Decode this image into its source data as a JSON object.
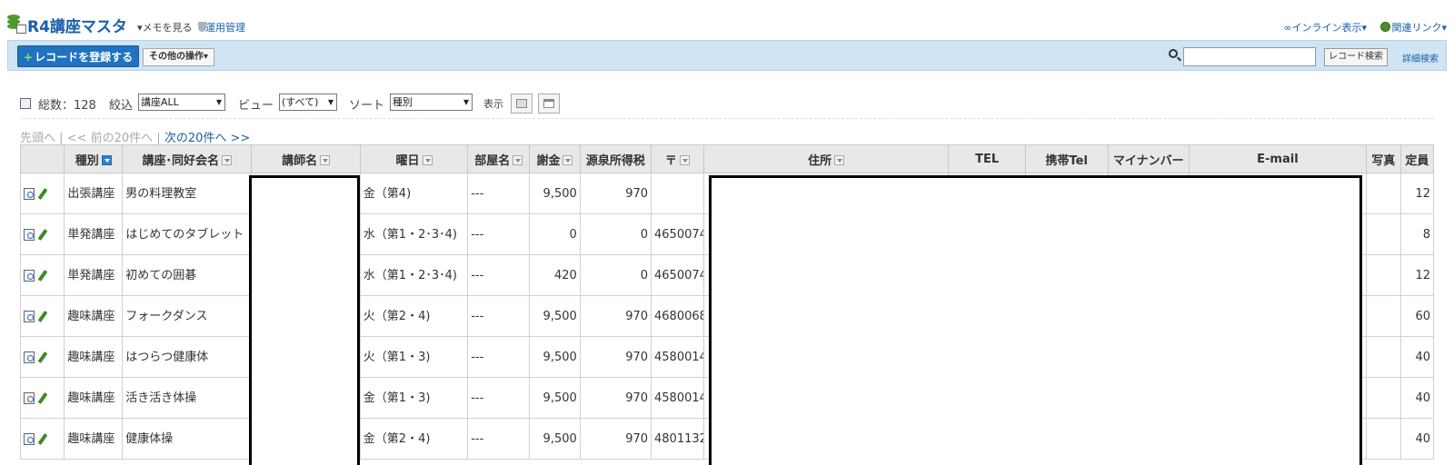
{
  "title": {
    "app": "R4講座マスタ",
    "memo": "▾メモを見る",
    "ops_admin": "運用管理",
    "inline_view": "∞インライン表示▾",
    "related_links": "関連リンク▾"
  },
  "toolbar": {
    "add_record": "レコードを登録する",
    "other_ops": "その他の操作▾",
    "search_placeholder": "",
    "search_button": "レコード検索",
    "advanced_search": "詳細検索"
  },
  "filter": {
    "total_label": "総数：128",
    "filter_label": "絞込",
    "filter_value": "講座ALL",
    "view_label": "ビュー",
    "view_value": "(すべて)",
    "sort_label": "ソート",
    "sort_value": "種別",
    "display_label": "表示"
  },
  "pager": {
    "first": "先頭へ",
    "sep1": "|",
    "prev": "<< 前の20件へ",
    "sep2": "|",
    "next": "次の20件へ >>"
  },
  "table": {
    "headers": [
      "",
      "種別",
      "講座･同好会名",
      "講師名",
      "曜日",
      "部屋名",
      "謝金",
      "源泉所得税",
      "〒",
      "住所",
      "TEL",
      "携帯Tel",
      "マイナンバー",
      "E-mail",
      "写真",
      "定員"
    ],
    "rows": [
      {
        "type": "出張講座",
        "name": "男の料理教室",
        "day": "金（第4)",
        "room": "---",
        "fee": "9,500",
        "tax": "970",
        "zip": "",
        "capacity": "12"
      },
      {
        "type": "単発講座",
        "name": "はじめてのタブレット",
        "day": "水（第1・2･3･4)",
        "room": "---",
        "fee": "0",
        "tax": "0",
        "zip": "4650074",
        "capacity": "8"
      },
      {
        "type": "単発講座",
        "name": "初めての囲碁",
        "day": "水（第1・2･3･4)",
        "room": "---",
        "fee": "420",
        "tax": "0",
        "zip": "4650074",
        "capacity": "12"
      },
      {
        "type": "趣味講座",
        "name": "フォークダンス",
        "day": "火（第2・4)",
        "room": "---",
        "fee": "9,500",
        "tax": "970",
        "zip": "4680068",
        "capacity": "60"
      },
      {
        "type": "趣味講座",
        "name": "はつらつ健康体",
        "day": "火（第1・3)",
        "room": "---",
        "fee": "9,500",
        "tax": "970",
        "zip": "4580014",
        "capacity": "40"
      },
      {
        "type": "趣味講座",
        "name": "活き活き体操",
        "day": "金（第1・3)",
        "room": "---",
        "fee": "9,500",
        "tax": "970",
        "zip": "4580014",
        "capacity": "40"
      },
      {
        "type": "趣味講座",
        "name": "健康体操",
        "day": "金（第2・4)",
        "room": "---",
        "fee": "9,500",
        "tax": "970",
        "zip": "4801132",
        "capacity": "40"
      }
    ]
  }
}
